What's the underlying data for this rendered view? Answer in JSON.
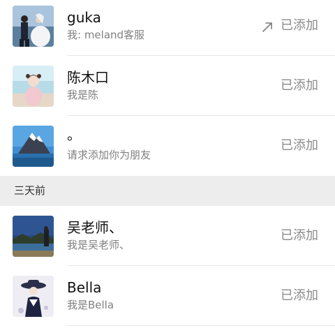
{
  "requests": [
    {
      "name": "guka",
      "message": "我: meland客服",
      "status": "已添加",
      "status_icon": "arrow-up-right-icon",
      "avatar": "wedding-couple-avatar"
    },
    {
      "name": "陈木口",
      "message": "我是陈",
      "status": "已添加",
      "status_icon": "",
      "avatar": "child-portrait-avatar"
    },
    {
      "name": "。",
      "message": "请求添加你为朋友",
      "status": "已添加",
      "status_icon": "",
      "avatar": "mountain-avatar"
    }
  ],
  "section": {
    "label": "三天前"
  },
  "older_requests": [
    {
      "name": "吴老师、",
      "message": "我是吴老师、",
      "status": "已添加",
      "avatar": "lake-avatar"
    },
    {
      "name": "Bella",
      "message": "我是Bella",
      "status": "已添加",
      "avatar": "hat-figure-avatar"
    }
  ],
  "colors": {
    "name_text": "#111111",
    "secondary_text": "#808080",
    "status_text": "#8a8a8a",
    "section_bg": "#ededed",
    "divider": "#e6e6e6"
  }
}
